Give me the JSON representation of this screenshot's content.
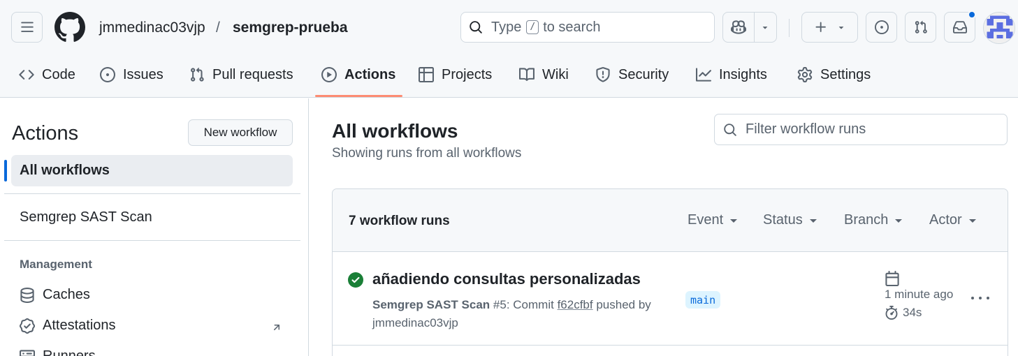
{
  "header": {
    "owner": "jmmedinac03vjp",
    "separator": "/",
    "repo": "semgrep-prueba",
    "search_prefix": "Type",
    "search_key": "/",
    "search_suffix": "to search"
  },
  "tabs": [
    {
      "label": "Code",
      "icon": "code-icon"
    },
    {
      "label": "Issues",
      "icon": "issue-icon"
    },
    {
      "label": "Pull requests",
      "icon": "pull-request-icon"
    },
    {
      "label": "Actions",
      "icon": "play-icon",
      "active": true
    },
    {
      "label": "Projects",
      "icon": "table-icon"
    },
    {
      "label": "Wiki",
      "icon": "book-icon"
    },
    {
      "label": "Security",
      "icon": "shield-icon"
    },
    {
      "label": "Insights",
      "icon": "graph-icon"
    },
    {
      "label": "Settings",
      "icon": "gear-icon"
    }
  ],
  "sidebar": {
    "title": "Actions",
    "new_workflow": "New workflow",
    "all_workflows": "All workflows",
    "workflow": "Semgrep SAST Scan",
    "management_heading": "Management",
    "management_items": [
      {
        "label": "Caches",
        "icon": "database-icon"
      },
      {
        "label": "Attestations",
        "icon": "verified-icon"
      },
      {
        "label": "Runners",
        "icon": "server-icon"
      }
    ]
  },
  "main": {
    "title": "All workflows",
    "subtitle": "Showing runs from all workflows",
    "filter_placeholder": "Filter workflow runs",
    "runs_count": "7 workflow runs",
    "filters": [
      "Event",
      "Status",
      "Branch",
      "Actor"
    ],
    "runs": [
      {
        "title": "añadiendo consultas personalizadas",
        "workflow": "Semgrep SAST Scan",
        "number": "#5",
        "commit_prefix": ": Commit",
        "sha": "f62cfbf",
        "pushed_by": "pushed by",
        "actor": "jmmedinac03vjp",
        "branch": "main",
        "time_ago": "1 minute ago",
        "duration": "34s",
        "status": "success"
      }
    ]
  },
  "colors": {
    "accent": "#0969da",
    "success": "#1a7f37",
    "tab_underline": "#fd8c73"
  }
}
